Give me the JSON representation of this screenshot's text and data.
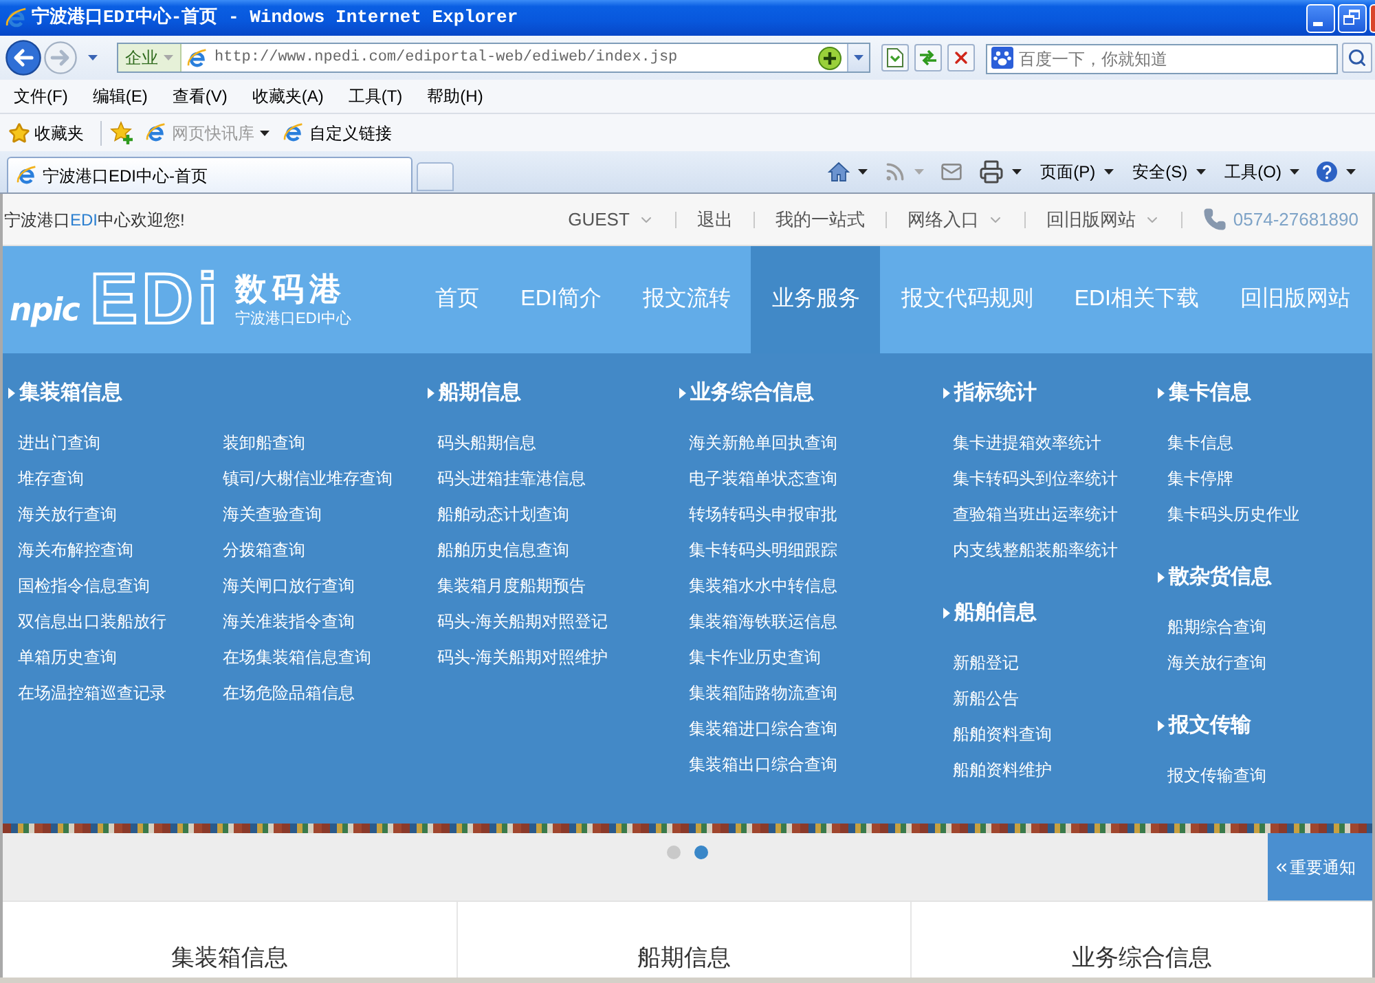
{
  "window": {
    "title": "宁波港口EDI中心-首页 - Windows Internet Explorer"
  },
  "address_bar": {
    "zone": "企业",
    "url": "http://www.npedi.com/ediportal-web/ediweb/index.jsp",
    "search": {
      "placeholder": "百度一下，你就知道"
    }
  },
  "menu_bar": [
    "文件(F)",
    "编辑(E)",
    "查看(V)",
    "收藏夹(A)",
    "工具(T)",
    "帮助(H)"
  ],
  "favorites_bar": {
    "label": "收藏夹",
    "links": [
      {
        "label": "网页快讯库",
        "disabled": true,
        "dropdown": true
      },
      {
        "label": "自定义链接",
        "disabled": false,
        "dropdown": false
      }
    ]
  },
  "tabs": [
    {
      "label": "宁波港口EDI中心-首页",
      "selected": true
    }
  ],
  "command_bar": [
    "页面(P)",
    "安全(S)",
    "工具(O)"
  ],
  "site": {
    "welcome": [
      {
        "text": "宁波港口",
        "highlight": false
      },
      {
        "text": "EDI",
        "highlight": true
      },
      {
        "text": "中心欢迎您!",
        "highlight": false
      }
    ],
    "top_links": [
      {
        "label": "GUEST",
        "dropdown": true
      },
      {
        "label": "退出",
        "dropdown": false
      },
      {
        "label": "我的一站式",
        "dropdown": false
      },
      {
        "label": "网络入口",
        "dropdown": true
      },
      {
        "label": "回旧版网站",
        "dropdown": true
      }
    ],
    "phone": "0574-27681890",
    "logo": {
      "brand": "npic",
      "mark": "EDi",
      "name": "数码港",
      "subtitle": "宁波港口EDI中心"
    },
    "nav": [
      {
        "label": "首页",
        "selected": false
      },
      {
        "label": "EDI简介",
        "selected": false
      },
      {
        "label": "报文流转",
        "selected": false
      },
      {
        "label": "业务服务",
        "selected": true
      },
      {
        "label": "报文代码规则",
        "selected": false
      },
      {
        "label": "EDI相关下载",
        "selected": false
      },
      {
        "label": "回旧版网站",
        "selected": false
      }
    ],
    "mega_menu": [
      {
        "groups": [
          {
            "title": "集装箱信息",
            "lists": [
              [
                "进出门查询",
                "堆存查询",
                "海关放行查询",
                "海关布解控查询",
                "国检指令信息查询",
                "双信息出口装船放行",
                "单箱历史查询",
                "在场温控箱巡查记录"
              ],
              [
                "装卸船查询",
                "镇司/大榭信业堆存查询",
                "海关查验查询",
                "分拨箱查询",
                "海关闸口放行查询",
                "海关准装指令查询",
                "在场集装箱信息查询",
                "在场危险品箱信息"
              ]
            ]
          }
        ]
      },
      {
        "groups": [
          {
            "title": "船期信息",
            "lists": [
              [
                "码头船期信息",
                "码头进箱挂靠港信息",
                "船舶动态计划查询",
                "船舶历史信息查询",
                "集装箱月度船期预告",
                "码头-海关船期对照登记",
                "码头-海关船期对照维护"
              ]
            ]
          }
        ]
      },
      {
        "groups": [
          {
            "title": "业务综合信息",
            "lists": [
              [
                "海关新舱单回执查询",
                "电子装箱单状态查询",
                "转场转码头申报审批",
                "集卡转码头明细跟踪",
                "集装箱水水中转信息",
                "集装箱海铁联运信息",
                "集卡作业历史查询",
                "集装箱陆路物流查询",
                "集装箱进口综合查询",
                "集装箱出口综合查询"
              ]
            ]
          }
        ]
      },
      {
        "groups": [
          {
            "title": "指标统计",
            "lists": [
              [
                "集卡进提箱效率统计",
                "集卡转码头到位率统计",
                "查验箱当班出运率统计",
                "内支线整船装船率统计"
              ]
            ]
          },
          {
            "title": "船舶信息",
            "lists": [
              [
                "新船登记",
                "新船公告",
                "船舶资料查询",
                "船舶资料维护"
              ]
            ]
          }
        ]
      },
      {
        "groups": [
          {
            "title": "集卡信息",
            "lists": [
              [
                "集卡信息",
                "集卡停牌",
                "集卡码头历史作业"
              ]
            ]
          },
          {
            "title": "散杂货信息",
            "lists": [
              [
                "船期综合查询",
                "海关放行查询"
              ]
            ]
          },
          {
            "title": "报文传输",
            "lists": [
              [
                "报文传输查询"
              ]
            ]
          }
        ]
      }
    ],
    "carousel": {
      "dots": [
        {
          "selected": false
        },
        {
          "selected": true
        }
      ]
    },
    "notice_tab": "重要通知",
    "cards": [
      {
        "title": "集装箱信息"
      },
      {
        "title": "船期信息"
      },
      {
        "title": "业务综合信息"
      }
    ]
  }
}
